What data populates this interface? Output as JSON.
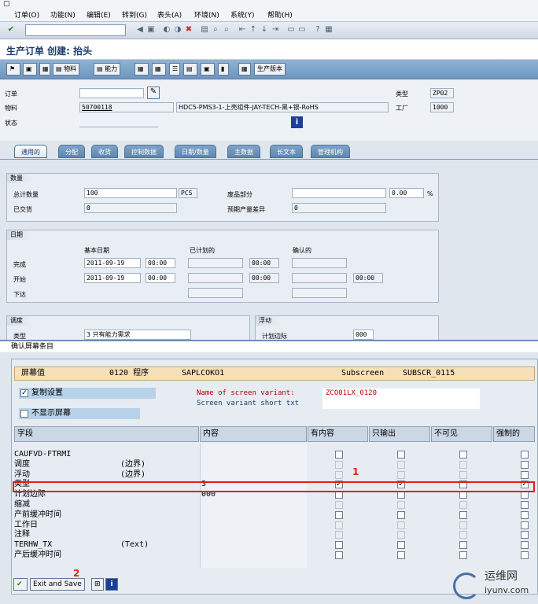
{
  "menu": {
    "items": [
      "订单(O)",
      "功能(N)",
      "编辑(E)",
      "转到(G)",
      "表头(A)",
      "环境(N)",
      "系统(Y)",
      "帮助(H)"
    ]
  },
  "title": "生产订单 创建: 抬头",
  "toolbar2": {
    "material": "物料",
    "capacity": "能力",
    "version": "生产版本"
  },
  "header": {
    "order_label": "订单",
    "material_label": "物料",
    "status_label": "状态",
    "material_value": "50700118",
    "material_desc": "HDC5-PMS3-1-上壳组件-JAY-TECH-黑+银-RoHS",
    "type_label": "类型",
    "type_value": "ZP02",
    "plant_label": "工厂",
    "plant_value": "1000"
  },
  "tabs": [
    "通用的",
    "分配",
    "收货",
    "控制数据",
    "日期/数量",
    "主数据",
    "长文本",
    "管理机构"
  ],
  "qty": {
    "title": "数量",
    "total_label": "总计数量",
    "total_value": "100",
    "unit": "PCS",
    "scrap_label": "废品部分",
    "scrap_pct": "0.00",
    "pct": "%",
    "delivered_label": "已交货",
    "delivered_value": "0",
    "expected_label": "预期产量差异",
    "expected_value": "0"
  },
  "dates": {
    "title": "日期",
    "basic": "基本日期",
    "scheduled": "已计划的",
    "confirmed": "确认的",
    "finish_label": "完成",
    "finish_date": "2011-09-19",
    "finish_time": "00:00",
    "finish_time2": "00:00",
    "start_label": "开始",
    "start_date": "2011-09-19",
    "start_time": "00:00",
    "start_time2": "00:00",
    "start_time3": "00:00",
    "release_label": "下达"
  },
  "scheduling": {
    "title": "调度",
    "type_label": "类型",
    "type_value": "3 只有能力需求",
    "float_title": "浮动",
    "horizon_label": "计划边际",
    "horizon_value": "000"
  },
  "popup": {
    "title": "确认屏幕条目",
    "screen_value": "屏幕值",
    "program_code": "0120 程序",
    "program": "SAPLCOKO1",
    "subscreen": "Subscreen",
    "subscreen_name": "SUBSCR_0115",
    "copy_settings": "复制设置",
    "hide_screen": "不显示屏幕",
    "variant_label": "Name of screen variant:",
    "variant_value": "ZCO01LX_0120",
    "short_txt_label": "Screen variant short txt",
    "col_field": "字段",
    "col_content": "内容",
    "col_has_content": "有内容",
    "col_output": "只输出",
    "col_invisible": "不可见",
    "col_required": "强制的",
    "rows": [
      {
        "name": "CAUFVD-FTRMI",
        "sub": "",
        "value": "",
        "c1": false,
        "c2": false,
        "c3": false,
        "c4": false,
        "dis": false
      },
      {
        "name": "调度",
        "sub": "(边界)",
        "value": "",
        "c1": false,
        "c2": false,
        "c3": false,
        "c4": false,
        "dis": true
      },
      {
        "name": "浮动",
        "sub": "(边界)",
        "value": "",
        "c1": false,
        "c2": false,
        "c3": false,
        "c4": false,
        "dis": true
      },
      {
        "name": "类型",
        "sub": "",
        "value": "3",
        "c1": true,
        "c2": true,
        "c3": false,
        "c4": true,
        "dis": false
      },
      {
        "name": "计划边际",
        "sub": "",
        "value": "000",
        "c1": false,
        "c2": false,
        "c3": false,
        "c4": false,
        "dis": false
      },
      {
        "name": "缩减",
        "sub": "",
        "value": "",
        "c1": false,
        "c2": false,
        "c3": false,
        "c4": false,
        "dis": true
      },
      {
        "name": "产前缓冲时间",
        "sub": "",
        "value": "",
        "c1": false,
        "c2": false,
        "c3": false,
        "c4": false,
        "dis": false
      },
      {
        "name": "工作日",
        "sub": "",
        "value": "",
        "c1": false,
        "c2": false,
        "c3": false,
        "c4": false,
        "dis": true
      },
      {
        "name": "注释",
        "sub": "",
        "value": "",
        "c1": false,
        "c2": false,
        "c3": false,
        "c4": false,
        "dis": true
      },
      {
        "name": "TERHW_TX",
        "sub": "(Text)",
        "value": "",
        "c1": false,
        "c2": false,
        "c3": false,
        "c4": false,
        "dis": false
      },
      {
        "name": "产后缓冲时间",
        "sub": "",
        "value": "",
        "c1": false,
        "c2": false,
        "c3": false,
        "c4": false,
        "dis": false
      }
    ],
    "exit_save": "Exit and Save",
    "annotation1": "1",
    "annotation2": "2"
  },
  "watermark": {
    "cn": "运维网",
    "url": "iyunv.com"
  }
}
